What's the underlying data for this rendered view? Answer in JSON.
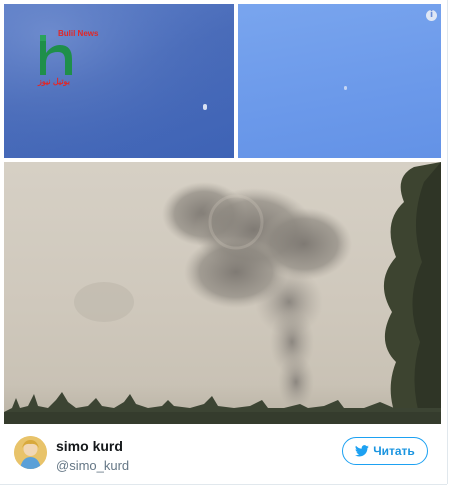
{
  "tweet": {
    "user": {
      "display_name": "simo kurd",
      "handle": "@simo_kurd"
    },
    "follow_label": "Читать",
    "accent_color": "#1da1f2",
    "icons": [
      "info-icon",
      "twitter-bird-icon"
    ]
  },
  "media": {
    "count": 3,
    "watermark": {
      "brand": "Bulil News",
      "arabic": "بوتيل نيوز",
      "logo_letter": "b"
    }
  }
}
